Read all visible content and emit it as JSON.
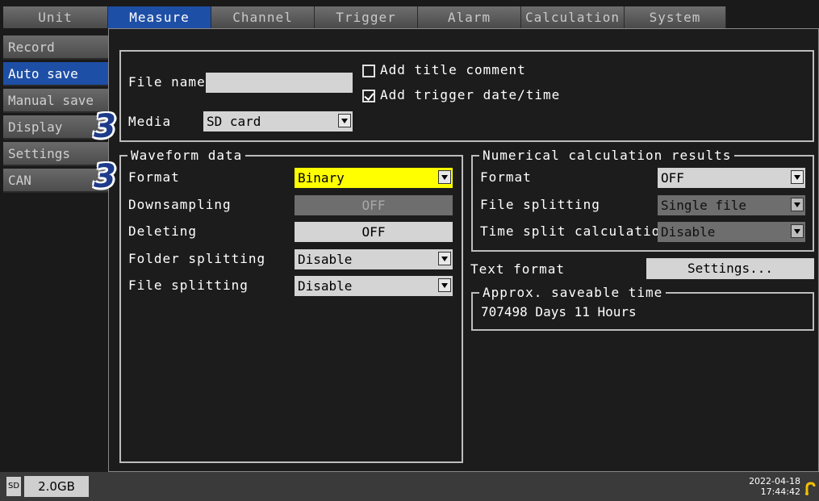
{
  "tabs": [
    "Unit",
    "Measure",
    "Channel",
    "Trigger",
    "Alarm",
    "Calculation",
    "System"
  ],
  "active_tab": "Measure",
  "sidebar": [
    "Record",
    "Auto save",
    "Manual save",
    "Display",
    "Settings",
    "CAN"
  ],
  "active_sidebar": "Auto save",
  "file": {
    "name_label": "File name",
    "name_value": "",
    "media_label": "Media",
    "media_value": "SD card",
    "add_title_comment": "Add title comment",
    "add_title_comment_checked": false,
    "add_trigger_datetime": "Add trigger date/time",
    "add_trigger_datetime_checked": true
  },
  "waveform": {
    "title": "Waveform data",
    "format_label": "Format",
    "format_value": "Binary",
    "downsampling_label": "Downsampling",
    "downsampling_value": "OFF",
    "deleting_label": "Deleting",
    "deleting_value": "OFF",
    "folder_splitting_label": "Folder splitting",
    "folder_splitting_value": "Disable",
    "file_splitting_label": "File splitting",
    "file_splitting_value": "Disable"
  },
  "numerical": {
    "title": "Numerical calculation results",
    "format_label": "Format",
    "format_value": "OFF",
    "file_splitting_label": "File splitting",
    "file_splitting_value": "Single file",
    "time_split_label": "Time split calculation",
    "time_split_value": "Disable"
  },
  "text_format": {
    "label": "Text format",
    "button": "Settings..."
  },
  "saveable": {
    "title": "Approx. saveable time",
    "value": "707498 Days 11 Hours"
  },
  "callouts": {
    "step1": "3",
    "step2": "3"
  },
  "status": {
    "media_icon": "SD",
    "capacity": "2.0GB",
    "date": "2022-04-18",
    "time": "17:44:42"
  },
  "colors": {
    "accent": "#1e4fa6",
    "highlight": "#ffff00",
    "callout": "#1d3b8a"
  }
}
